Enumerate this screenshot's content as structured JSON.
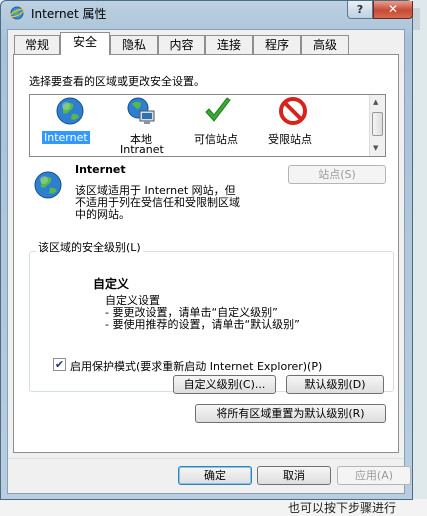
{
  "window": {
    "title": "Internet 属性",
    "help_label": "?",
    "close_label": "✕",
    "icon": "ie-globe-icon"
  },
  "tabs": [
    {
      "label": "常规"
    },
    {
      "label": "安全",
      "active": true
    },
    {
      "label": "隐私"
    },
    {
      "label": "内容"
    },
    {
      "label": "连接"
    },
    {
      "label": "程序"
    },
    {
      "label": "高级"
    }
  ],
  "security": {
    "instruction": "选择要查看的区域或更改安全设置。",
    "zones": [
      {
        "label": "Internet",
        "icon": "globe-icon",
        "selected": true
      },
      {
        "label": "本地",
        "label2": "Intranet",
        "icon": "local-intranet-icon"
      },
      {
        "label": "可信站点",
        "icon": "check-mark-icon"
      },
      {
        "label": "受限站点",
        "icon": "restricted-icon"
      }
    ],
    "zone_title": "Internet",
    "zone_desc": [
      "该区域适用于 Internet 网站，但",
      "不适用于列在受信任和受限制区域",
      "中的网站。"
    ],
    "sites_button": "站点(S)",
    "level_group_label": "该区域的安全级别(L)",
    "level_name": "自定义",
    "level_desc": [
      "自定义设置",
      "- 要更改设置，请单击“自定义级别”",
      "- 要使用推荐的设置，请单击“默认级别”"
    ],
    "protected_mode_label": "启用保护模式(要求重新启动 Internet Explorer)(P)",
    "protected_mode_checked": true,
    "custom_level_button": "自定义级别(C)...",
    "default_level_button": "默认级别(D)",
    "reset_all_button": "将所有区域重置为默认级别(R)"
  },
  "dialog_buttons": {
    "ok": "确定",
    "cancel": "取消",
    "apply": "应用(A)"
  },
  "background": {
    "bottom_text": "也可以按下步骤进行"
  }
}
